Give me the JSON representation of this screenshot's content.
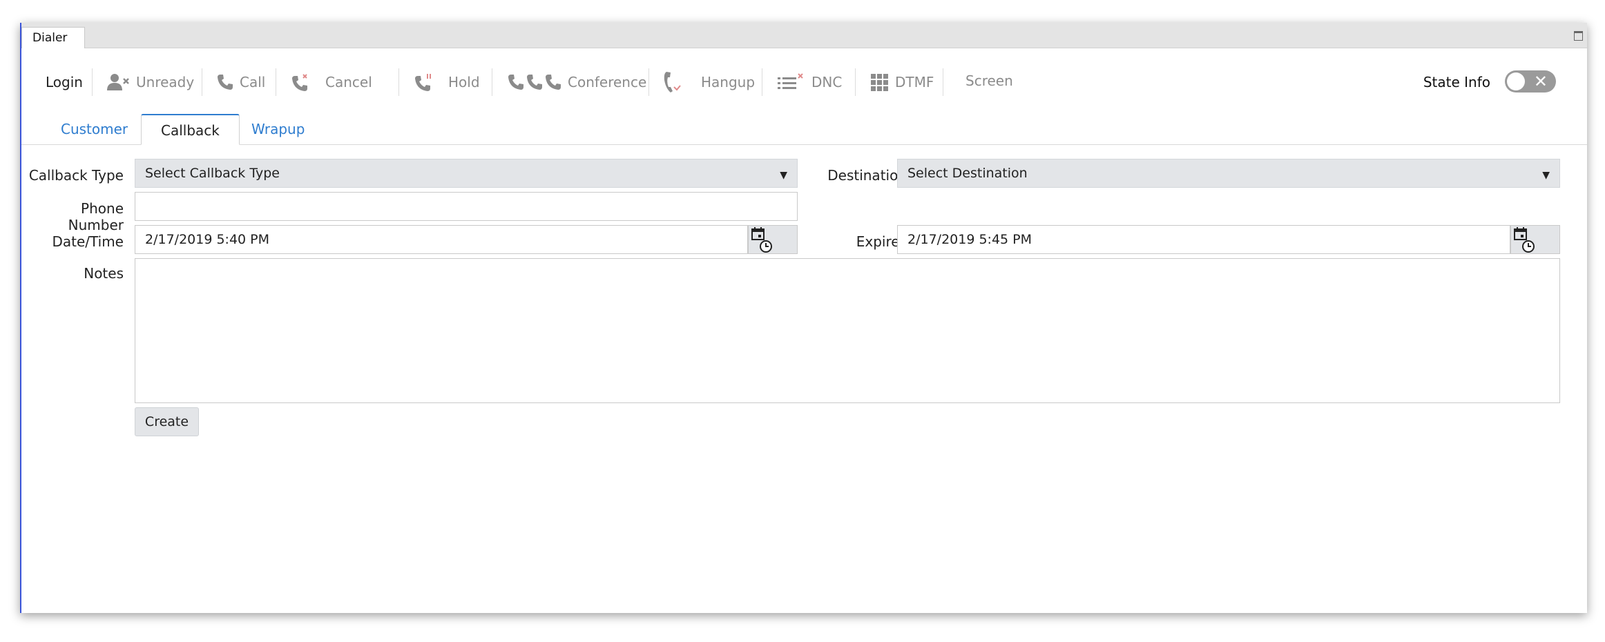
{
  "window": {
    "title": "Dialer"
  },
  "toolbar": {
    "login": "Login",
    "unready": "Unready",
    "call": "Call",
    "cancel": "Cancel",
    "hold": "Hold",
    "conference": "Conference",
    "hangup": "Hangup",
    "dnc": "DNC",
    "dtmf": "DTMF",
    "screen": "Screen",
    "state_info": "State Info"
  },
  "tabs": [
    {
      "label": "Customer",
      "active": false
    },
    {
      "label": "Callback",
      "active": true
    },
    {
      "label": "Wrapup",
      "active": false
    }
  ],
  "form": {
    "callback_type_label": "Callback Type",
    "callback_type_value": "Select Callback Type",
    "destination_label": "Destination",
    "destination_value": "Select Destination",
    "phone_label": "Phone Number",
    "phone_value": "",
    "datetime_label": "Date/Time",
    "datetime_value": "2/17/2019 5:40 PM",
    "expires_label": "Expires",
    "expires_value": "2/17/2019 5:45 PM",
    "notes_label": "Notes",
    "notes_value": "",
    "create_button": "Create"
  },
  "colors": {
    "accent": "#2f7dcf",
    "window_border": "#3b55d9",
    "toggle_off": "#9a9a9a"
  },
  "icons": [
    "user-x-icon",
    "phone-icon",
    "phone-cancel-icon",
    "phone-hold-icon",
    "conference-icon",
    "hangup-icon",
    "dnc-list-icon",
    "dtmf-grid-icon",
    "calendar-icon",
    "clock-icon",
    "close-icon",
    "maximize-icon"
  ]
}
